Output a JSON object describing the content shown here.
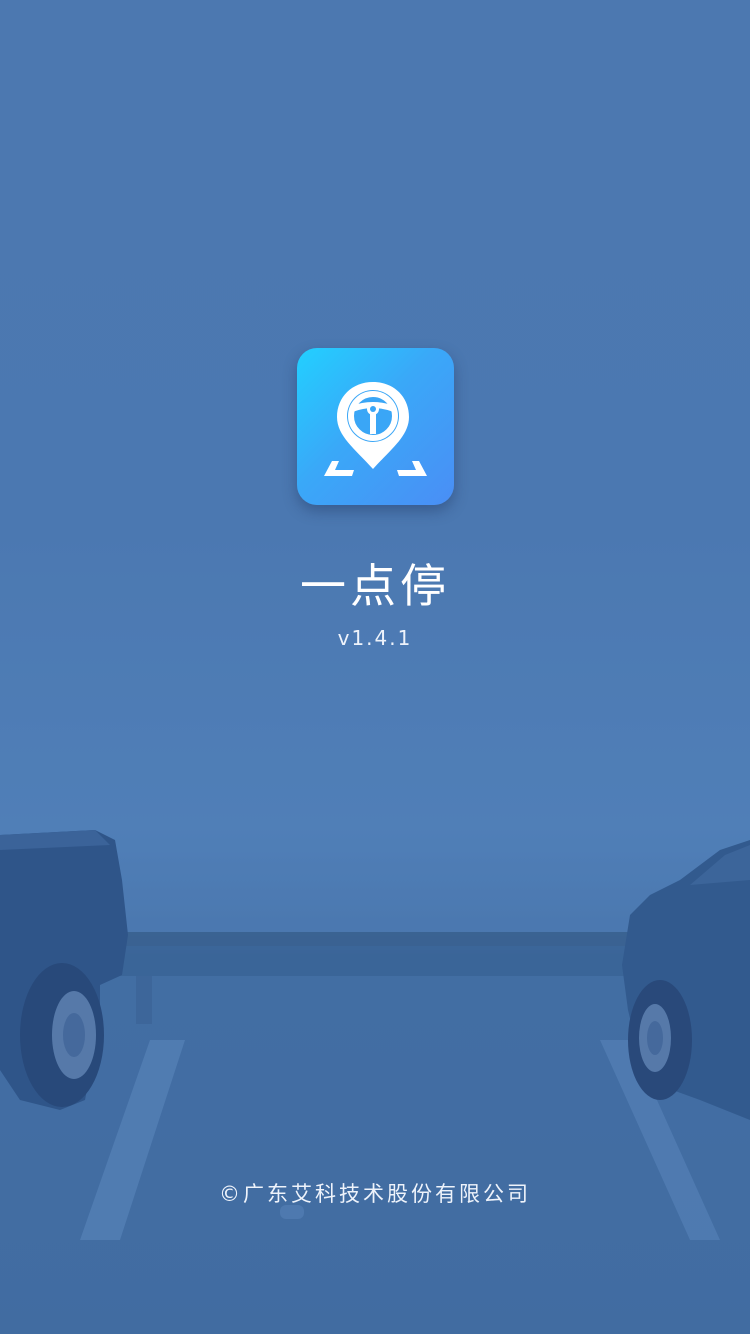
{
  "splash": {
    "app_name": "一点停",
    "version": "v1.4.1",
    "copyright": "©广东艾科技术股份有限公司",
    "logo_icon": "steering-wheel-location-pin-icon",
    "background": "parking-lot-photo",
    "colors": {
      "overlay": "#4a77ad",
      "logo_gradient_start": "#22d0ff",
      "logo_gradient_end": "#4a8ef5",
      "text": "#ffffff"
    }
  }
}
